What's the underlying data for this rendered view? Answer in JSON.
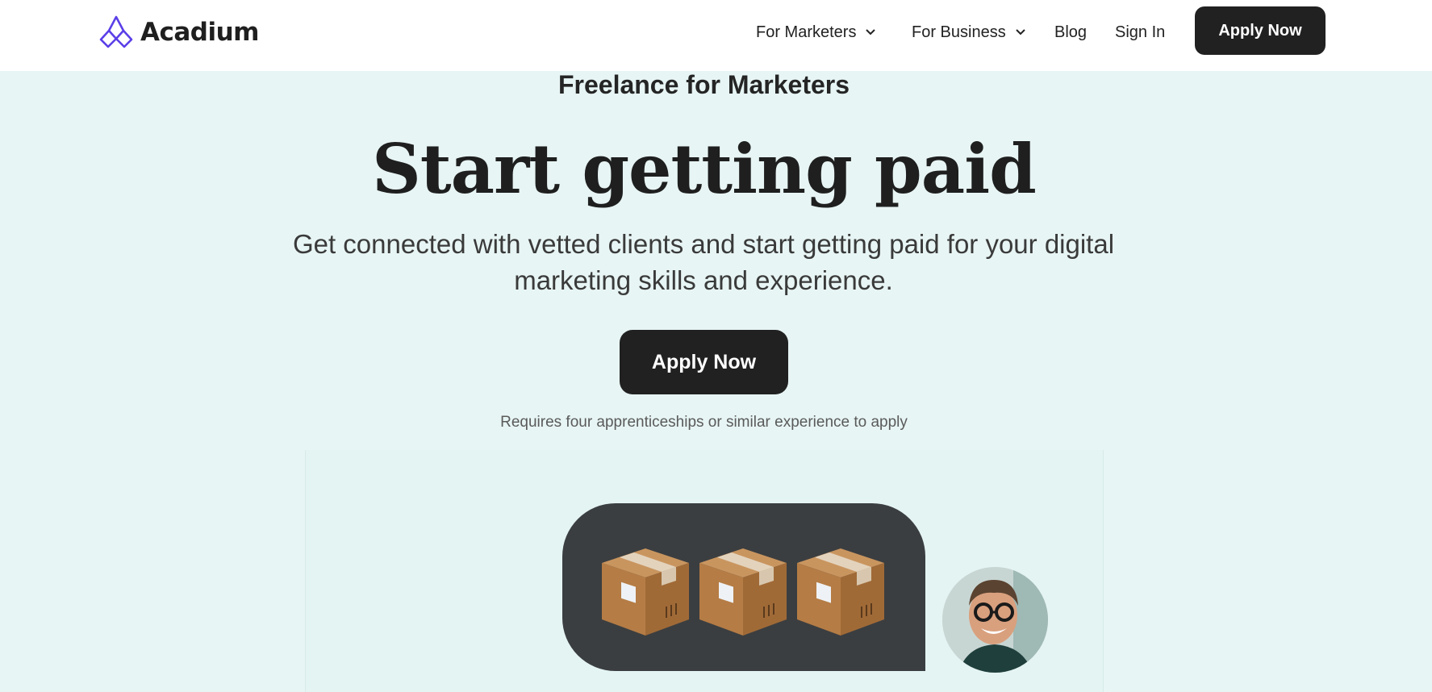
{
  "brand": {
    "name": "Acadium",
    "accent": "#5b3fe8"
  },
  "nav": {
    "for_marketers": "For Marketers",
    "for_business": "For Business",
    "blog": "Blog",
    "sign_in": "Sign In",
    "apply_now": "Apply Now"
  },
  "hero": {
    "eyebrow": "Freelance for Marketers",
    "headline": "Start getting paid",
    "subheadline_line1": "Get connected with vetted clients and start getting paid for your digital",
    "subheadline_line2": "marketing skills and experience.",
    "cta": "Apply Now",
    "note": "Requires four apprenticeships or similar experience to apply"
  },
  "illustration": {
    "items": [
      "package-icon",
      "package-icon",
      "package-icon"
    ],
    "avatar": "user-avatar"
  },
  "colors": {
    "background": "#e7f5f4",
    "button": "#212121",
    "bubble": "#3b3e40"
  }
}
